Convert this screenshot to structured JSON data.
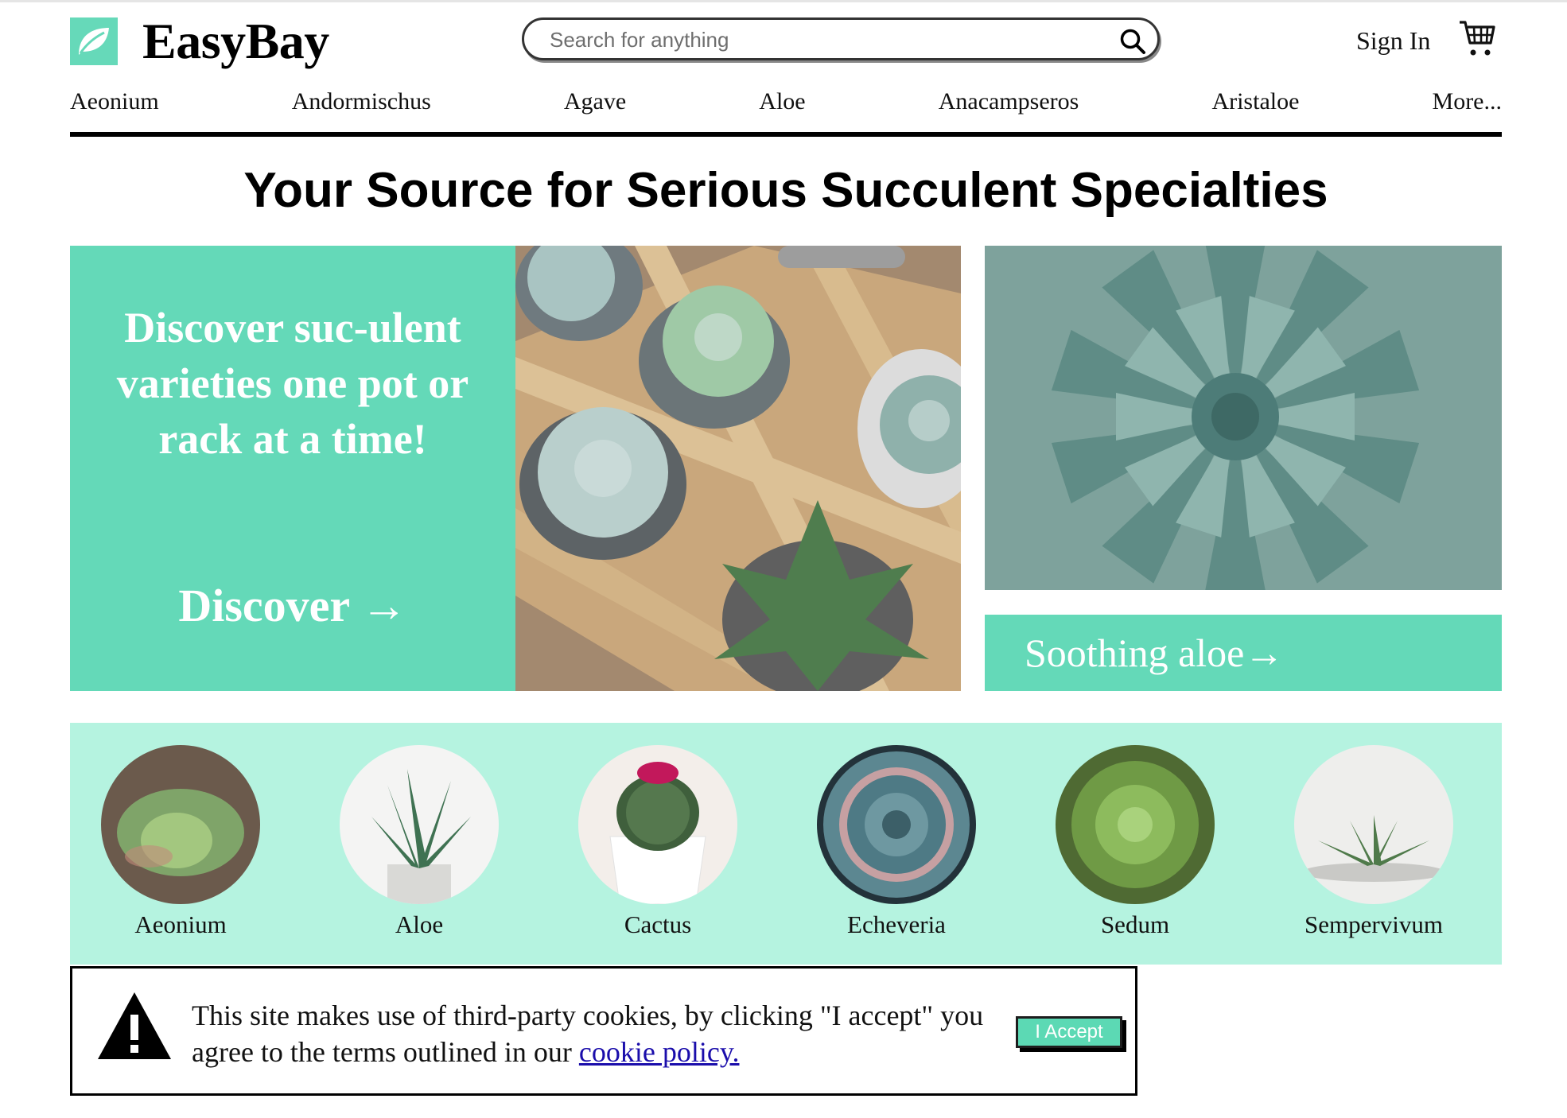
{
  "header": {
    "brand": "EasyBay",
    "search_placeholder": "Search for anything",
    "sign_in": "Sign In"
  },
  "nav": {
    "items": [
      "Aeonium",
      "Andormischus",
      "Agave",
      "Aloe",
      "Anacampseros",
      "Aristaloe",
      "More..."
    ]
  },
  "main": {
    "headline": "Your Source for Serious Succulent Specialties",
    "promo": {
      "title": "Discover suc-ulent varieties one pot or rack at a time!",
      "link": "Discover →"
    },
    "aloe_link": "Soothing aloe→"
  },
  "categories": [
    {
      "label": "Aeonium"
    },
    {
      "label": "Aloe"
    },
    {
      "label": "Cactus"
    },
    {
      "label": "Echeveria"
    },
    {
      "label": "Sedum"
    },
    {
      "label": "Sempervivum"
    }
  ],
  "cookie": {
    "text": "This site makes use of third-party cookies, by clicking \"I accept\" you agree to the terms outlined in our ",
    "link": "cookie policy.",
    "accept": "I Accept"
  },
  "colors": {
    "accent": "#64d9b8",
    "strip": "#b5f3e0",
    "link": "#1a0dab"
  }
}
